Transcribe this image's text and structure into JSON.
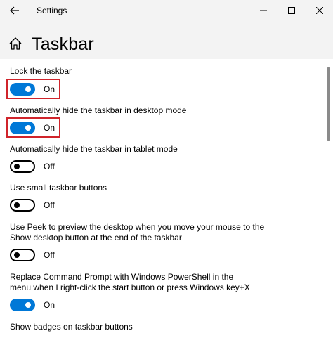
{
  "window": {
    "title": "Settings",
    "back_icon": "back-arrow-icon",
    "minimize_icon": "minimize-icon",
    "maximize_icon": "maximize-icon",
    "close_icon": "close-icon"
  },
  "page": {
    "title": "Taskbar",
    "icon": "home-icon"
  },
  "colors": {
    "accent": "#0078d7",
    "highlight": "#d0242b",
    "header_bg": "#f3f3f3"
  },
  "settings": [
    {
      "label": "Lock the taskbar",
      "state": "On",
      "on": true,
      "highlighted": true
    },
    {
      "label": "Automatically hide the taskbar in desktop mode",
      "state": "On",
      "on": true,
      "highlighted": true
    },
    {
      "label": "Automatically hide the taskbar in tablet mode",
      "state": "Off",
      "on": false
    },
    {
      "label": "Use small taskbar buttons",
      "state": "Off",
      "on": false
    },
    {
      "label": "Use Peek to preview the desktop when you move your mouse to the Show desktop button at the end of the taskbar",
      "state": "Off",
      "on": false
    },
    {
      "label": "Replace Command Prompt with Windows PowerShell in the menu when I right-click the start button or press Windows key+X",
      "state": "On",
      "on": true
    },
    {
      "label": "Show badges on taskbar buttons"
    }
  ]
}
